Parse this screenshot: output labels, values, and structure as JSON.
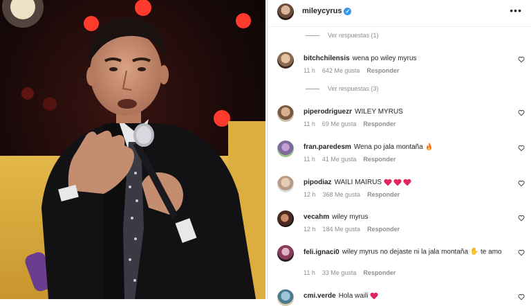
{
  "header": {
    "username": "mileycyrus",
    "more_label": "•••"
  },
  "replies_top": {
    "label": "Ver respuestas (1)"
  },
  "replies_mid": {
    "label": "Ver respuestas (3)"
  },
  "comments": [
    {
      "user": "bitchchilensis",
      "text": "wena po wiley myrus",
      "time": "11 h",
      "likes": "642 Me gusta",
      "reply": "Responder"
    },
    {
      "user": "piperodriguezr",
      "text": "WILEY MYRUS",
      "time": "11 h",
      "likes": "69 Me gusta",
      "reply": "Responder"
    },
    {
      "user": "fran.paredesm",
      "text": "Wena po jala montaña",
      "time": "11 h",
      "likes": "41 Me gusta",
      "reply": "Responder"
    },
    {
      "user": "pipodiaz",
      "text": "WAILI MAIRUS",
      "time": "12 h",
      "likes": "368 Me gusta",
      "reply": "Responder"
    },
    {
      "user": "vecahm",
      "text": "wiley myrus",
      "time": "12 h",
      "likes": "184 Me gusta",
      "reply": "Responder"
    },
    {
      "user": "feli.ignaci0",
      "text": "wiley myrus no dejaste ni la jala montaña",
      "text2": "te amo",
      "time": "11 h",
      "likes": "33 Me gusta",
      "reply": "Responder"
    },
    {
      "user": "cmi.verde",
      "text": "Hola waili"
    }
  ],
  "colors": {
    "accent_blue": "#3897f0",
    "emoji_red": "#e0245e"
  }
}
